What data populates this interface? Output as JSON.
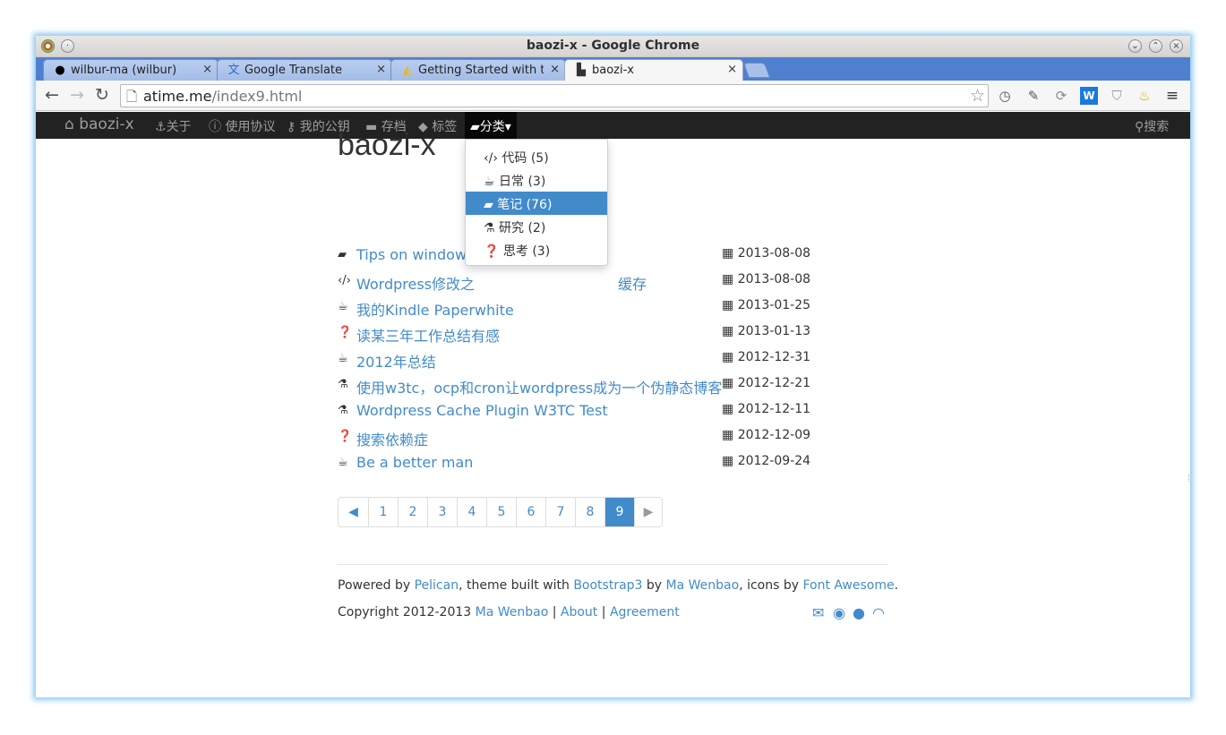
{
  "window": {
    "title": "baozi-x - Google Chrome"
  },
  "tabs": [
    {
      "label": "wilbur-ma (wilbur)",
      "icon": "github-icon"
    },
    {
      "label": "Google Translate",
      "icon": "translate-icon"
    },
    {
      "label": "Getting Started with the",
      "icon": "google-drive-icon"
    },
    {
      "label": "baozi-x",
      "icon": "page-icon"
    }
  ],
  "tab_close": "×",
  "address_bar": {
    "host": "atime.me",
    "path": "/index9.html"
  },
  "navbar": {
    "brand": "baozi-x",
    "about": "关于",
    "terms": "使用协议",
    "pubkey": "我的公钥",
    "archive": "存档",
    "tags": "标签",
    "category": "分类",
    "search": "搜索"
  },
  "dropdown": {
    "items": [
      {
        "label": "代码 (5)",
        "icon": "code-icon"
      },
      {
        "label": "日常 (3)",
        "icon": "coffee-icon"
      },
      {
        "label": "笔记 (76)",
        "icon": "book-icon"
      },
      {
        "label": "研究 (2)",
        "icon": "flask-icon"
      },
      {
        "label": "思考 (3)",
        "icon": "question-circle-icon"
      }
    ]
  },
  "main": {
    "title": "baozi-x",
    "posts": [
      {
        "title": "Tips on windows",
        "date": "2013-08-08",
        "icon": "book-icon"
      },
      {
        "title": "Wordpress修改之",
        "title_tail": "缓存",
        "date": "2013-08-08",
        "icon": "code-icon"
      },
      {
        "title": "我的Kindle Paperwhite",
        "date": "2013-01-25",
        "icon": "coffee-icon"
      },
      {
        "title": "读某三年工作总结有感",
        "date": "2013-01-13",
        "icon": "question-circle-icon"
      },
      {
        "title": "2012年总结",
        "date": "2012-12-31",
        "icon": "coffee-icon"
      },
      {
        "title": "使用w3tc，ocp和cron让wordpress成为一个伪静态博客",
        "date": "2012-12-21",
        "icon": "flask-icon"
      },
      {
        "title": "Wordpress Cache Plugin W3TC Test",
        "date": "2012-12-11",
        "icon": "flask-icon"
      },
      {
        "title": "搜索依赖症",
        "date": "2012-12-09",
        "icon": "question-circle-icon"
      },
      {
        "title": "Be a better man",
        "date": "2012-09-24",
        "icon": "coffee-icon"
      }
    ],
    "pagination": {
      "pages": [
        "1",
        "2",
        "3",
        "4",
        "5",
        "6",
        "7",
        "8",
        "9"
      ],
      "current": "9"
    }
  },
  "footer": {
    "line1": {
      "t1": "Powered by ",
      "pelican": "Pelican",
      "t2": ", theme built with ",
      "bootstrap": "Bootstrap3",
      "t3": " by ",
      "author": "Ma Wenbao",
      "t4": ", icons by ",
      "fontawesome": "Font Awesome",
      "t5": "."
    },
    "line2": {
      "t1": "Copyright 2012-2013 ",
      "author": "Ma Wenbao",
      "sep1": " | ",
      "about": "About",
      "sep2": " | ",
      "agreement": "Agreement"
    },
    "social": [
      "email-icon",
      "weibo-icon",
      "github-icon",
      "rss-icon"
    ]
  },
  "colors": {
    "link": "#428bca",
    "navbar": "#222222",
    "tabstrip": "#4f80d0"
  }
}
